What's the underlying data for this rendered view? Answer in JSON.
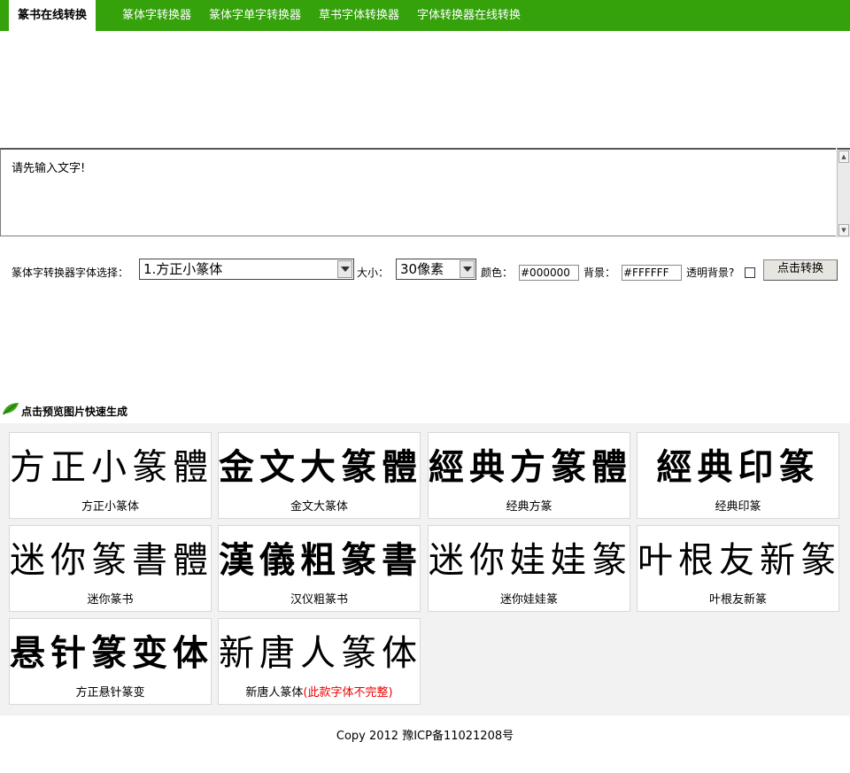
{
  "nav": {
    "brand": "篆书在线转换",
    "links": [
      "篆体字转换器",
      "篆体字单字转换器",
      "草书字体转换器",
      "字体转换器在线转换"
    ]
  },
  "editor": {
    "text": "请先输入文字!"
  },
  "controls": {
    "font_label": "篆体字转换器字体选择：",
    "font_selected": "1.方正小篆体",
    "size_label": "大小：",
    "size_selected": "30像素",
    "color_label": "颜色：",
    "color_value": "#000000",
    "bg_label": "背景：",
    "bg_value": "#FFFFFF",
    "transparent_label": "透明背景?",
    "transparent_checked": false,
    "convert_label": "点击转换"
  },
  "preview": {
    "title": "点击预览图片快速生成",
    "cards": [
      {
        "sample": "方正小篆體",
        "caption": "方正小篆体"
      },
      {
        "sample": "金文大篆體",
        "caption": "金文大篆体"
      },
      {
        "sample": "經典方篆體",
        "caption": "经典方篆"
      },
      {
        "sample": "經典印篆",
        "caption": "经典印篆"
      },
      {
        "sample": "迷你篆書體",
        "caption": "迷你篆书"
      },
      {
        "sample": "漢儀粗篆書",
        "caption": "汉仪粗篆书"
      },
      {
        "sample": "迷你娃娃篆",
        "caption": "迷你娃娃篆"
      },
      {
        "sample": "叶根友新篆",
        "caption": "叶根友新篆"
      },
      {
        "sample": "悬针篆变体",
        "caption": "方正悬针篆变"
      },
      {
        "sample": "新唐人篆体",
        "caption": "新唐人篆体",
        "caption_note": "(此款字体不完整)"
      }
    ]
  },
  "footer": {
    "text": "Copy 2012 豫ICP备11021208号"
  },
  "colors": {
    "nav_bg": "#35a20b",
    "warning": "#ee0000"
  }
}
